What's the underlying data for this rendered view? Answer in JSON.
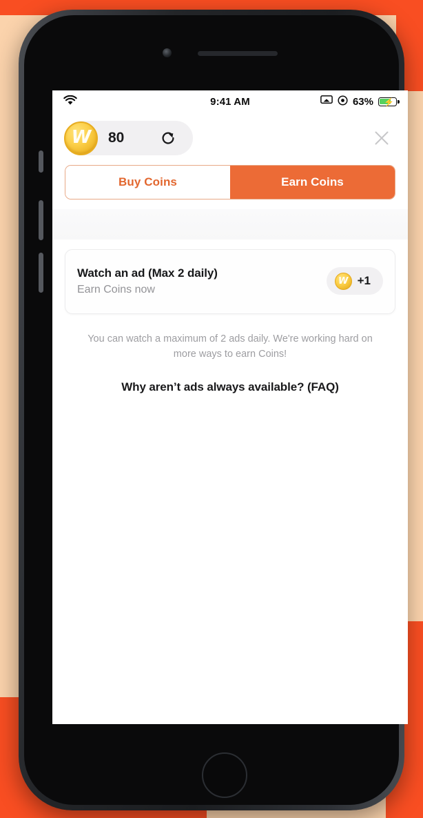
{
  "backdrop": {
    "orange": "#F94E22",
    "peach": "#FBD3AC"
  },
  "device": {
    "camera_icon": "camera-icon",
    "speaker_icon": "speaker-grille-icon",
    "home_button": "home-button"
  },
  "status_bar": {
    "wifi_icon": "wifi-icon",
    "time": "9:41 AM",
    "airplay_icon": "screen-mirroring-icon",
    "rotation_lock_icon": "rotation-lock-icon",
    "battery_percent": "63%",
    "battery_icon": "battery-charging-icon"
  },
  "header": {
    "coin_icon": "coin-icon",
    "coin_glyph": "W",
    "balance": "80",
    "refresh_icon": "refresh-icon",
    "close_icon": "close-icon"
  },
  "tabs": {
    "active_index": 1,
    "items": [
      {
        "label": "Buy Coins",
        "active": false
      },
      {
        "label": "Earn Coins",
        "active": true
      }
    ],
    "active_color": "#ec6b36",
    "inactive_text_color": "#e2672f",
    "border_color": "#e8a886"
  },
  "main": {
    "offer_card": {
      "title": "Watch an ad (Max 2 daily)",
      "subtitle": "Earn Coins now",
      "reward_coin_icon": "coin-icon",
      "reward_coin_glyph": "W",
      "reward_amount": "+1"
    },
    "note": "You can watch a maximum of 2 ads daily. We're working hard on more ways to earn Coins!",
    "faq_link": "Why aren’t ads always available? (FAQ)"
  }
}
